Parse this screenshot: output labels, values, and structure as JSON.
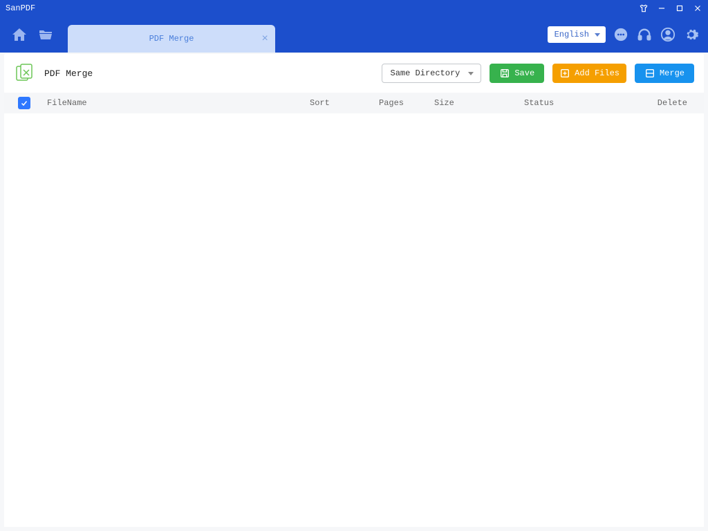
{
  "app": {
    "title": "SanPDF"
  },
  "language": {
    "selected": "English"
  },
  "tab": {
    "label": "PDF Merge"
  },
  "toolbar": {
    "title": "PDF Merge",
    "directory": "Same Directory",
    "save": "Save",
    "add_files": "Add Files",
    "merge": "Merge"
  },
  "table": {
    "headers": {
      "filename": "FileName",
      "sort": "Sort",
      "pages": "Pages",
      "size": "Size",
      "status": "Status",
      "delete": "Delete"
    }
  }
}
